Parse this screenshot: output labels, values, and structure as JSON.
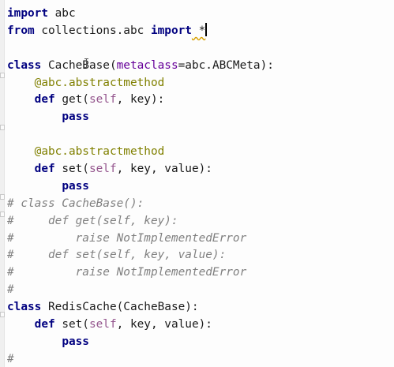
{
  "editor": {
    "lines": [
      [
        {
          "t": "import",
          "c": "kw"
        },
        {
          "t": " abc",
          "c": ""
        }
      ],
      [
        {
          "t": "from",
          "c": "kw"
        },
        {
          "t": " collections.abc ",
          "c": ""
        },
        {
          "t": "import",
          "c": "kw"
        },
        {
          "t": " *",
          "c": "warn"
        }
      ],
      [],
      [
        {
          "t": "class",
          "c": "kw"
        },
        {
          "t": " CacheBase(",
          "c": ""
        },
        {
          "t": "metaclass",
          "c": "kwarg"
        },
        {
          "t": "=abc.ABCMeta):",
          "c": ""
        }
      ],
      [
        {
          "t": "    ",
          "c": ""
        },
        {
          "t": "@abc.abstractmethod",
          "c": "deco"
        }
      ],
      [
        {
          "t": "    ",
          "c": ""
        },
        {
          "t": "def",
          "c": "kw"
        },
        {
          "t": " get(",
          "c": ""
        },
        {
          "t": "self",
          "c": "param-self"
        },
        {
          "t": ", key):",
          "c": ""
        }
      ],
      [
        {
          "t": "        ",
          "c": ""
        },
        {
          "t": "pass",
          "c": "kw"
        }
      ],
      [],
      [
        {
          "t": "    ",
          "c": ""
        },
        {
          "t": "@abc.abstractmethod",
          "c": "deco"
        }
      ],
      [
        {
          "t": "    ",
          "c": ""
        },
        {
          "t": "def",
          "c": "kw"
        },
        {
          "t": " set(",
          "c": ""
        },
        {
          "t": "self",
          "c": "param-self"
        },
        {
          "t": ", key, value):",
          "c": ""
        }
      ],
      [
        {
          "t": "        ",
          "c": ""
        },
        {
          "t": "pass",
          "c": "kw"
        }
      ],
      [
        {
          "t": "# class CacheBase():",
          "c": "comment"
        }
      ],
      [
        {
          "t": "#     def get(self, key):",
          "c": "comment"
        }
      ],
      [
        {
          "t": "#         raise NotImplementedError",
          "c": "comment"
        }
      ],
      [
        {
          "t": "#     def set(self, key, value):",
          "c": "comment"
        }
      ],
      [
        {
          "t": "#         raise NotImplementedError",
          "c": "comment"
        }
      ],
      [
        {
          "t": "#",
          "c": "comment"
        }
      ],
      [
        {
          "t": "class",
          "c": "kw"
        },
        {
          "t": " RedisCache(CacheBase):",
          "c": ""
        }
      ],
      [
        {
          "t": "    ",
          "c": ""
        },
        {
          "t": "def",
          "c": "kw"
        },
        {
          "t": " set(",
          "c": ""
        },
        {
          "t": "self",
          "c": "param-self"
        },
        {
          "t": ", key, value):",
          "c": ""
        }
      ],
      [
        {
          "t": "        ",
          "c": ""
        },
        {
          "t": "pass",
          "c": "kw"
        }
      ],
      [
        {
          "t": "#",
          "c": "comment"
        }
      ]
    ],
    "caret_line": 1,
    "colors": {
      "keyword": "#000080",
      "decorator": "#808000",
      "self": "#94558d",
      "kwarg": "#660099",
      "comment": "#808080",
      "background": "#fdfdfd"
    }
  }
}
